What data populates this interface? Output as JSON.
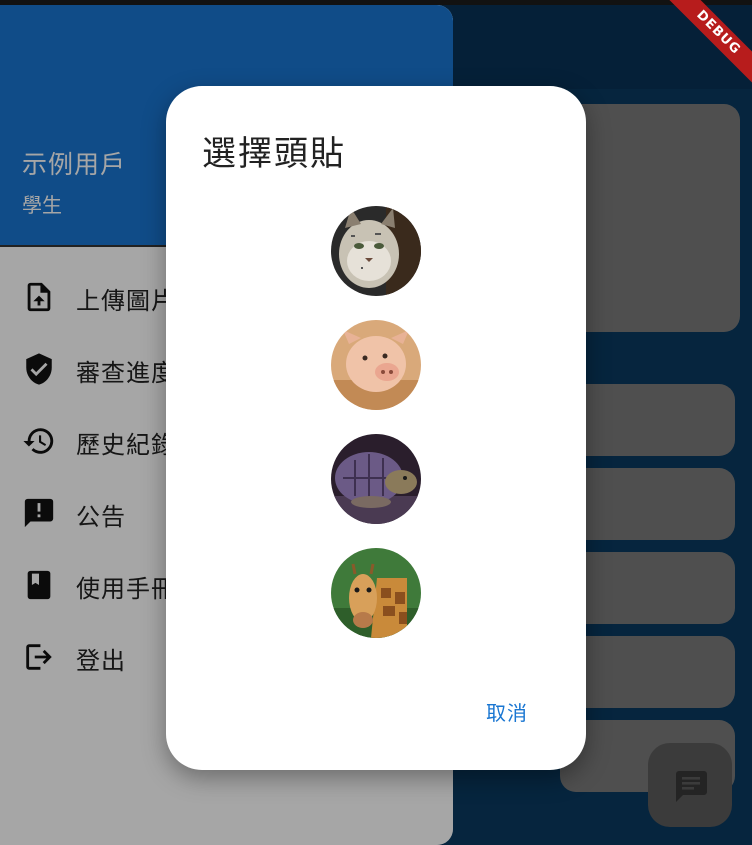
{
  "debug_banner": "DEBUG",
  "drawer": {
    "user_name": "示例用戶",
    "user_role": "學生",
    "items": [
      {
        "label": "上傳圖片",
        "icon": "upload-file-icon"
      },
      {
        "label": "審查進度",
        "icon": "verified-shield-icon"
      },
      {
        "label": "歷史紀錄",
        "icon": "history-icon"
      },
      {
        "label": "公告",
        "icon": "announcement-icon"
      },
      {
        "label": "使用手冊",
        "icon": "book-icon"
      },
      {
        "label": "登出",
        "icon": "logout-icon"
      }
    ]
  },
  "dialog": {
    "title": "選擇頭貼",
    "avatars": [
      {
        "name": "lynx-avatar"
      },
      {
        "name": "pig-avatar"
      },
      {
        "name": "tortoise-avatar"
      },
      {
        "name": "giraffe-avatar"
      }
    ],
    "cancel_label": "取消"
  },
  "fab": {
    "icon": "chat-icon"
  },
  "colors": {
    "primary": "#1976d2",
    "drawer_header": "#1976d2",
    "debug": "#b71c1c"
  }
}
